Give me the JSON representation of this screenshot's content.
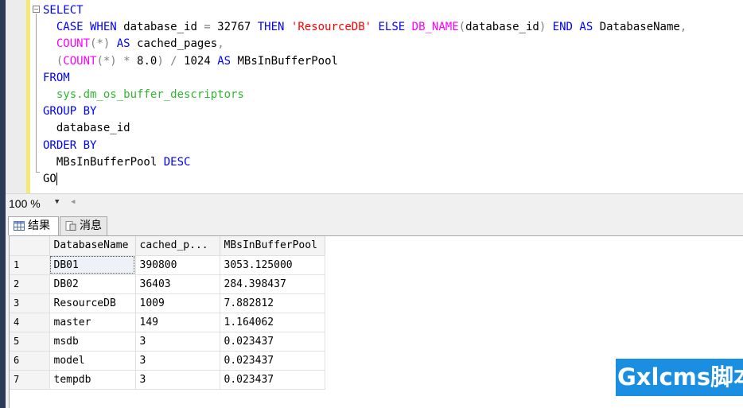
{
  "editor": {
    "lines": [
      [
        {
          "t": "SELECT",
          "c": "kw"
        }
      ],
      [
        {
          "t": "  CASE WHEN ",
          "c": "kw"
        },
        {
          "t": "database_id ",
          "c": ""
        },
        {
          "t": "= ",
          "c": "op"
        },
        {
          "t": "32767 ",
          "c": ""
        },
        {
          "t": "THEN ",
          "c": "kw"
        },
        {
          "t": "'ResourceDB' ",
          "c": "str"
        },
        {
          "t": "ELSE ",
          "c": "kw"
        },
        {
          "t": "DB_NAME",
          "c": "fn"
        },
        {
          "t": "(",
          "c": "op"
        },
        {
          "t": "database_id",
          "c": ""
        },
        {
          "t": ") ",
          "c": "op"
        },
        {
          "t": "END AS ",
          "c": "kw"
        },
        {
          "t": "DatabaseName",
          "c": ""
        },
        {
          "t": ",",
          "c": "op"
        }
      ],
      [
        {
          "t": "  COUNT",
          "c": "fn"
        },
        {
          "t": "(*) ",
          "c": "op"
        },
        {
          "t": "AS ",
          "c": "kw"
        },
        {
          "t": "cached_pages",
          "c": ""
        },
        {
          "t": ",",
          "c": "op"
        }
      ],
      [
        {
          "t": "  (",
          "c": "op"
        },
        {
          "t": "COUNT",
          "c": "fn"
        },
        {
          "t": "(*) * ",
          "c": "op"
        },
        {
          "t": "8.0",
          "c": ""
        },
        {
          "t": ") / ",
          "c": "op"
        },
        {
          "t": "1024 ",
          "c": ""
        },
        {
          "t": "AS ",
          "c": "kw"
        },
        {
          "t": "MBsInBufferPool",
          "c": ""
        }
      ],
      [
        {
          "t": "FROM",
          "c": "kw"
        }
      ],
      [
        {
          "t": "  sys.dm_os_buffer_descriptors",
          "c": "sys"
        }
      ],
      [
        {
          "t": "GROUP BY",
          "c": "kw"
        }
      ],
      [
        {
          "t": "  database_id",
          "c": ""
        }
      ],
      [
        {
          "t": "ORDER BY",
          "c": "kw"
        }
      ],
      [
        {
          "t": "  MBsInBufferPool ",
          "c": ""
        },
        {
          "t": "DESC",
          "c": "kw"
        }
      ],
      [
        {
          "t": "GO",
          "c": ""
        }
      ]
    ]
  },
  "status": {
    "zoom": "100 %"
  },
  "tabs": [
    {
      "label": "结果",
      "icon": "grid-icon"
    },
    {
      "label": "消息",
      "icon": "message-icon"
    }
  ],
  "grid": {
    "columns": [
      "",
      "DatabaseName",
      "cached_p...",
      "MBsInBufferPool"
    ],
    "rows": [
      [
        "1",
        "DB01",
        "390800",
        "3053.125000"
      ],
      [
        "2",
        "DB02",
        "36403",
        "284.398437"
      ],
      [
        "3",
        "ResourceDB",
        "1009",
        "7.882812"
      ],
      [
        "4",
        "master",
        "149",
        "1.164062"
      ],
      [
        "5",
        "msdb",
        "3",
        "0.023437"
      ],
      [
        "6",
        "model",
        "3",
        "0.023437"
      ],
      [
        "7",
        "tempdb",
        "3",
        "0.023437"
      ]
    ]
  },
  "watermark": {
    "text": "Gxlcms脚本",
    "color": "#1a8ee0"
  }
}
